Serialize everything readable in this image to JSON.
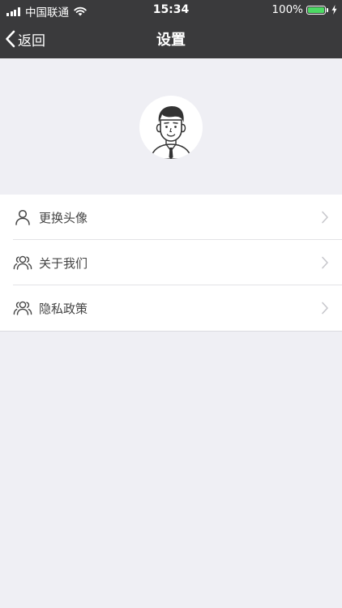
{
  "status_bar": {
    "carrier": "中国联通",
    "time": "15:34",
    "battery": "100%",
    "battery_level": 1.0,
    "battery_color": "#4cd964"
  },
  "nav": {
    "back_label": "返回",
    "title": "设置"
  },
  "menu": {
    "items": [
      {
        "label": "更换头像",
        "icon": "person-icon"
      },
      {
        "label": "关于我们",
        "icon": "group-icon"
      },
      {
        "label": "隐私政策",
        "icon": "group-icon"
      }
    ]
  },
  "colors": {
    "header_bg": "#3a3a3c",
    "page_bg": "#efeff4"
  }
}
